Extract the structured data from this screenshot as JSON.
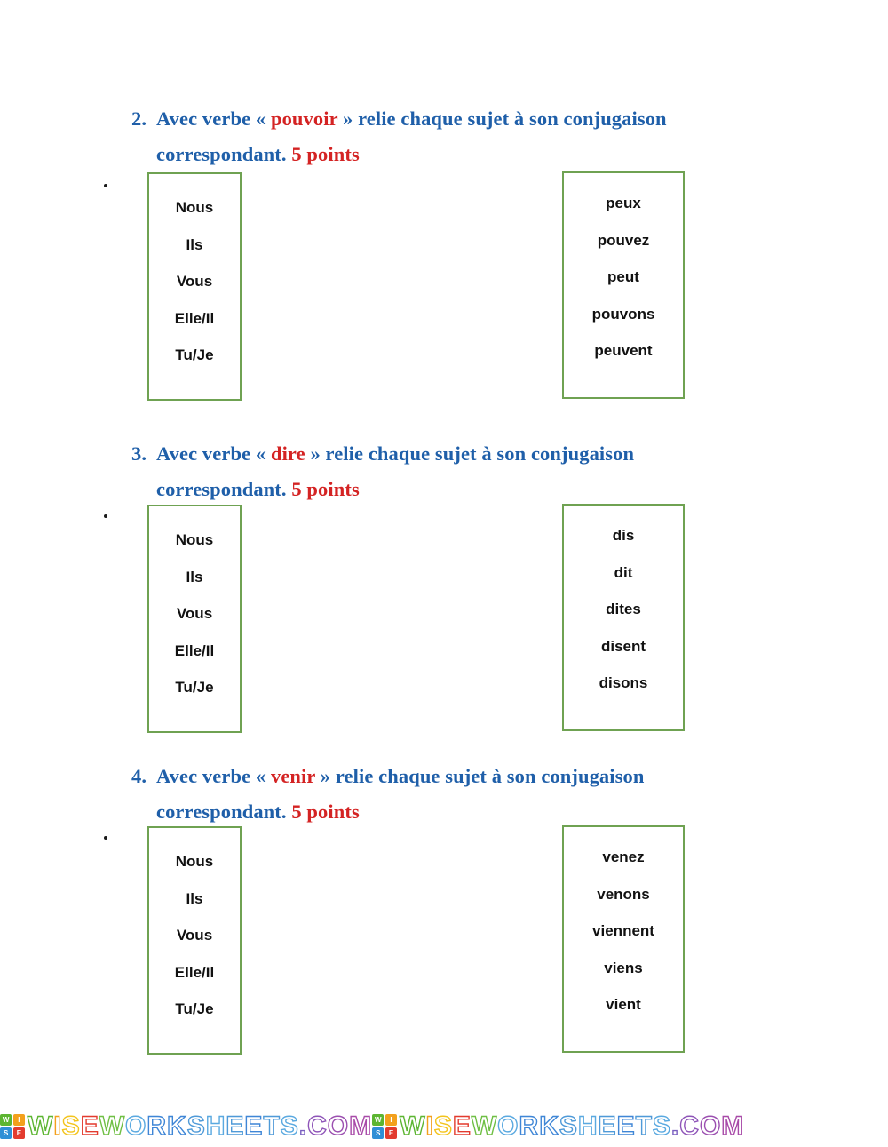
{
  "document": {
    "type": "french-conjugation-matching-worksheet",
    "background_color": "#ffffff",
    "heading_color": "#1f5fa9",
    "accent_color": "#d42323",
    "box_border_color": "#6fa252"
  },
  "exercises": [
    {
      "number": "2.",
      "text_before": "Avec verbe «",
      "verb": "pouvoir",
      "text_after": "» relie chaque sujet à son conjugaison",
      "line2_text": "correspondant.",
      "points": "5 points",
      "left_box": {
        "items": [
          "Nous",
          "Ils",
          "Vous",
          "Elle/Il",
          "Tu/Je"
        ]
      },
      "right_box": {
        "items": [
          "peux",
          "pouvez",
          "peut",
          "pouvons",
          "peuvent"
        ]
      }
    },
    {
      "number": "3.",
      "text_before": "Avec verbe «",
      "verb": "dire",
      "text_after": "» relie chaque sujet à son conjugaison",
      "line2_text": "correspondant.",
      "points": "5 points",
      "left_box": {
        "items": [
          "Nous",
          "Ils",
          "Vous",
          "Elle/Il",
          "Tu/Je"
        ]
      },
      "right_box": {
        "items": [
          "dis",
          "dit",
          "dites",
          "disent",
          "disons"
        ]
      }
    },
    {
      "number": "4.",
      "text_before": "Avec verbe «",
      "verb": "venir",
      "text_after": "» relie chaque sujet à son conjugaison",
      "line2_text": "correspondant.",
      "points": "5 points",
      "left_box": {
        "items": [
          "Nous",
          "Ils",
          "Vous",
          "Elle/Il",
          "Tu/Je"
        ]
      },
      "right_box": {
        "items": [
          "venez",
          "venons",
          "viennent",
          "viens",
          "vient"
        ]
      }
    }
  ],
  "watermark": {
    "logo_letters": [
      "W",
      "I",
      "S",
      "E"
    ],
    "text": "WISEWORKSHEETS.COM",
    "repetitions": 2,
    "letter_colors": [
      "#5cb531",
      "#f3a01c",
      "#f3c41c",
      "#e33b2e",
      "#6fbf44",
      "#5aa9e0",
      "#3f86d6",
      "#3f86d6",
      "#4f9ad8",
      "#5aa9e0",
      "#4f9ad8",
      "#3f86d6",
      "#4f9ad8",
      "#5aa9e0",
      "#7a5fc0",
      "#8e54b8",
      "#9b4fb0",
      "#a84aa8"
    ]
  }
}
